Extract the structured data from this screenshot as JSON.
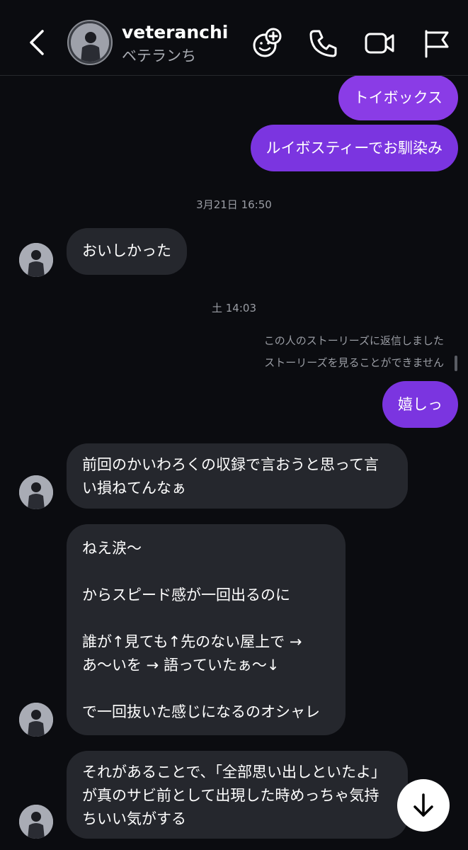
{
  "header": {
    "username": "veteranchi",
    "display_name": "ベテランち"
  },
  "icons": [
    "back-icon",
    "add-effect-icon",
    "phone-icon",
    "video-icon",
    "flag-icon",
    "arrow-down-icon"
  ],
  "colors": {
    "outgoing_bubble": "#8a3ce6",
    "incoming_bubble": "#25272d",
    "background": "#0b0c10"
  },
  "messages": {
    "out1": "トイボックス",
    "out2": "ルイボスティーでお馴染み",
    "stamp1": "3月21日 16:50",
    "in1": "おいしかった",
    "stamp2": "土 14:03",
    "story_note1": "この人のストーリーズに返信しました",
    "story_note2": "ストーリーズを見ることができません",
    "out3": "嬉しっ",
    "in2": "前回のかいわろくの収録で言おうと思って言\nい損ねてんなぁ",
    "in3": "ねえ涙〜\n\nからスピード感が一回出るのに\n\n誰が↑見ても↑先のない屋上で →\nあ〜いを → 語っていたぁ〜↓\n\nで一回抜いた感じになるのオシャレ",
    "in4": "それがあることで、「全部思い出しといたよ」\nが真のサビ前として出現した時めっちゃ気持\nちいい気がする"
  }
}
